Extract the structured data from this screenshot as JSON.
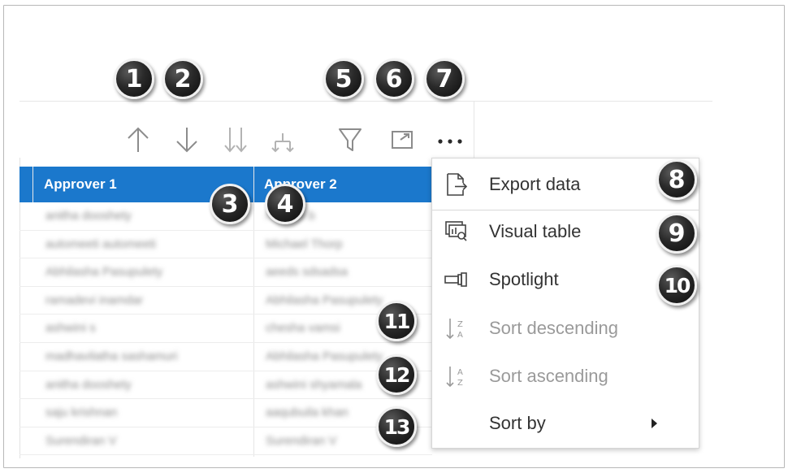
{
  "toolbar": {
    "icons": [
      {
        "name": "sort-up-arrow-icon",
        "enabled": false
      },
      {
        "name": "sort-down-arrow-icon",
        "enabled": false
      },
      {
        "name": "expand-all-down-icon",
        "enabled": false
      },
      {
        "name": "expand-hierarchy-icon",
        "enabled": false
      },
      {
        "name": "filter-icon",
        "enabled": false
      },
      {
        "name": "focus-mode-icon",
        "enabled": false
      },
      {
        "name": "more-options-icon",
        "enabled": true
      }
    ]
  },
  "table": {
    "columns": [
      "Approver 1",
      "Approver 2"
    ],
    "rows": [
      [
        "anitha dooshety",
        "Naresh b"
      ],
      [
        "automeeti automeeti",
        "Michael Thorp"
      ],
      [
        "Abhilasha Pasupulety",
        "aeeds sdsadsa"
      ],
      [
        "ramadevi inamdar",
        "Abhilasha Pasupulety"
      ],
      [
        "ashwini s",
        "chesha vamsi"
      ],
      [
        "madhavilatha sashamuri",
        "Abhilasha Pasupulety"
      ],
      [
        "anitha dooshety",
        "ashwini shyamala"
      ],
      [
        "saju krishnan",
        "aaqubuila khan"
      ],
      [
        "Surendiran V",
        "Surendiran V"
      ]
    ]
  },
  "menu": {
    "items": [
      {
        "label": "Export data",
        "icon": "export-data-icon",
        "enabled": true
      },
      {
        "label": "Visual table",
        "icon": "visual-table-icon",
        "enabled": true
      },
      {
        "label": "Spotlight",
        "icon": "spotlight-icon",
        "enabled": true
      },
      {
        "label": "Sort descending",
        "icon": "sort-descending-icon",
        "enabled": false
      },
      {
        "label": "Sort ascending",
        "icon": "sort-ascending-icon",
        "enabled": false
      },
      {
        "label": "Sort by",
        "icon": "",
        "enabled": true,
        "submenu": true
      }
    ]
  },
  "callouts": [
    "1",
    "2",
    "3",
    "4",
    "5",
    "6",
    "7",
    "8",
    "9",
    "10",
    "11",
    "12",
    "13"
  ],
  "colors": {
    "header_blue": "#1b78cc",
    "icon_disabled": "#8c8c8c",
    "menu_text": "#333333",
    "menu_text_disabled": "#9a9a9a"
  }
}
